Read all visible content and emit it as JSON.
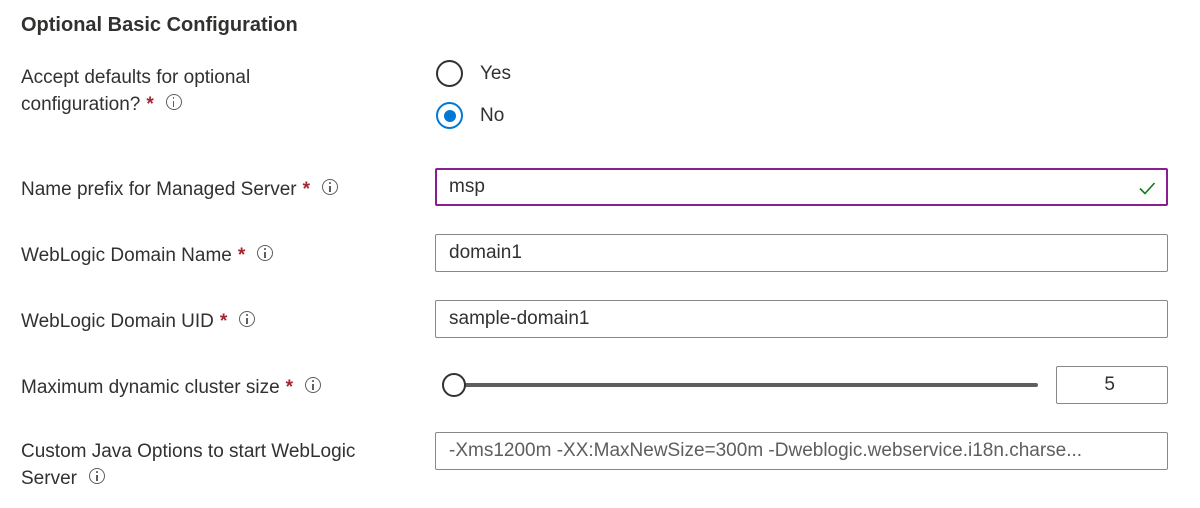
{
  "section_title": "Optional Basic Configuration",
  "accept_defaults": {
    "label_line1": "Accept defaults for optional",
    "label_line2": "configuration?",
    "options": [
      "Yes",
      "No"
    ],
    "selected": "No"
  },
  "managed_server_prefix": {
    "label": "Name prefix for Managed Server",
    "value": "msp"
  },
  "domain_name": {
    "label": "WebLogic Domain Name",
    "value": "domain1"
  },
  "domain_uid": {
    "label": "WebLogic Domain UID",
    "value": "sample-domain1"
  },
  "cluster_size": {
    "label": "Maximum dynamic cluster size",
    "value": "5"
  },
  "java_options": {
    "label_line1": "Custom Java Options to start WebLogic",
    "label_line2": "Server",
    "placeholder": "-Xms1200m -XX:MaxNewSize=300m -Dweblogic.webservice.i18n.charse..."
  },
  "required_mark": "*",
  "colors": {
    "accent": "#0078d4",
    "required": "#a4262c",
    "focus_border": "#8a1d8f",
    "valid_check": "#107c10"
  }
}
